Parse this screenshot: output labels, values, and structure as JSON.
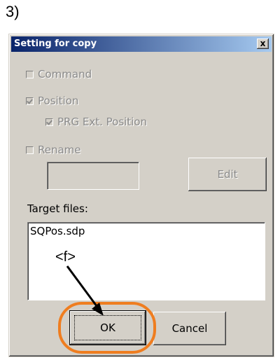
{
  "step_label": "3)",
  "dialog": {
    "title": "Setting for copy",
    "close_glyph": "x",
    "options": {
      "command": {
        "label": "Command",
        "checked": false
      },
      "position": {
        "label": "Position",
        "checked": true
      },
      "prg_ext_position": {
        "label": "PRG Ext. Position",
        "checked": true
      },
      "rename": {
        "label": "Rename",
        "checked": false
      }
    },
    "rename_value": "",
    "edit_label": "Edit",
    "target_files_label": "Target files:",
    "target_files": [
      "SQPos.sdp"
    ],
    "ok_label": "OK",
    "cancel_label": "Cancel"
  },
  "annotation": {
    "label": "<f>",
    "highlight_color": "#ef7d1f"
  },
  "colors": {
    "titlebar_start": "#0a246a",
    "titlebar_end": "#a6caf0",
    "dialog_bg": "#d4d0c8",
    "disabled_text": "#8a8a8a"
  }
}
